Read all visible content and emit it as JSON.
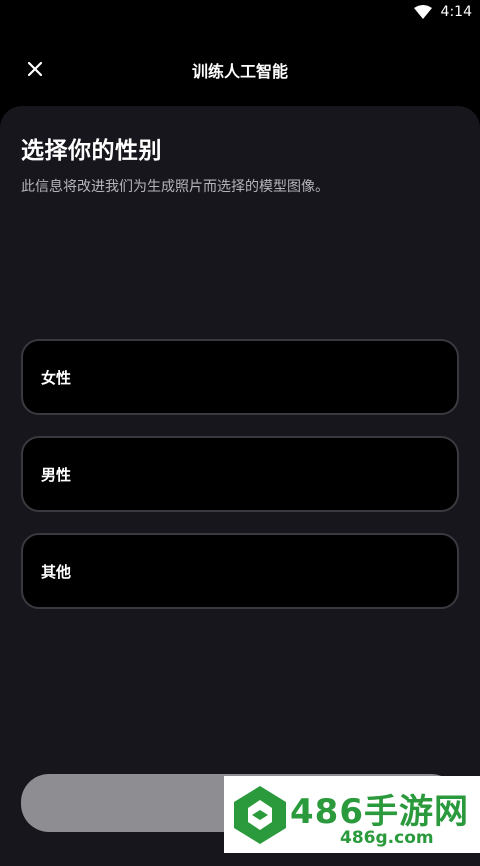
{
  "status_bar": {
    "time": "4:14",
    "wifi_icon": "wifi-icon"
  },
  "header": {
    "title": "训练人工智能",
    "close_icon": "close-icon"
  },
  "content": {
    "heading": "选择你的性别",
    "subheading": "此信息将改进我们为生成照片而选择的模型图像。",
    "options": [
      {
        "label": "女性"
      },
      {
        "label": "男性"
      },
      {
        "label": "其他"
      }
    ]
  },
  "watermark": {
    "main": "486手游网",
    "sub": "486g.com"
  },
  "colors": {
    "background": "#000000",
    "sheet": "#17161c",
    "option_border": "#3a3940",
    "disabled_button": "#8e8d91",
    "watermark_green": "#2a9a3c"
  }
}
